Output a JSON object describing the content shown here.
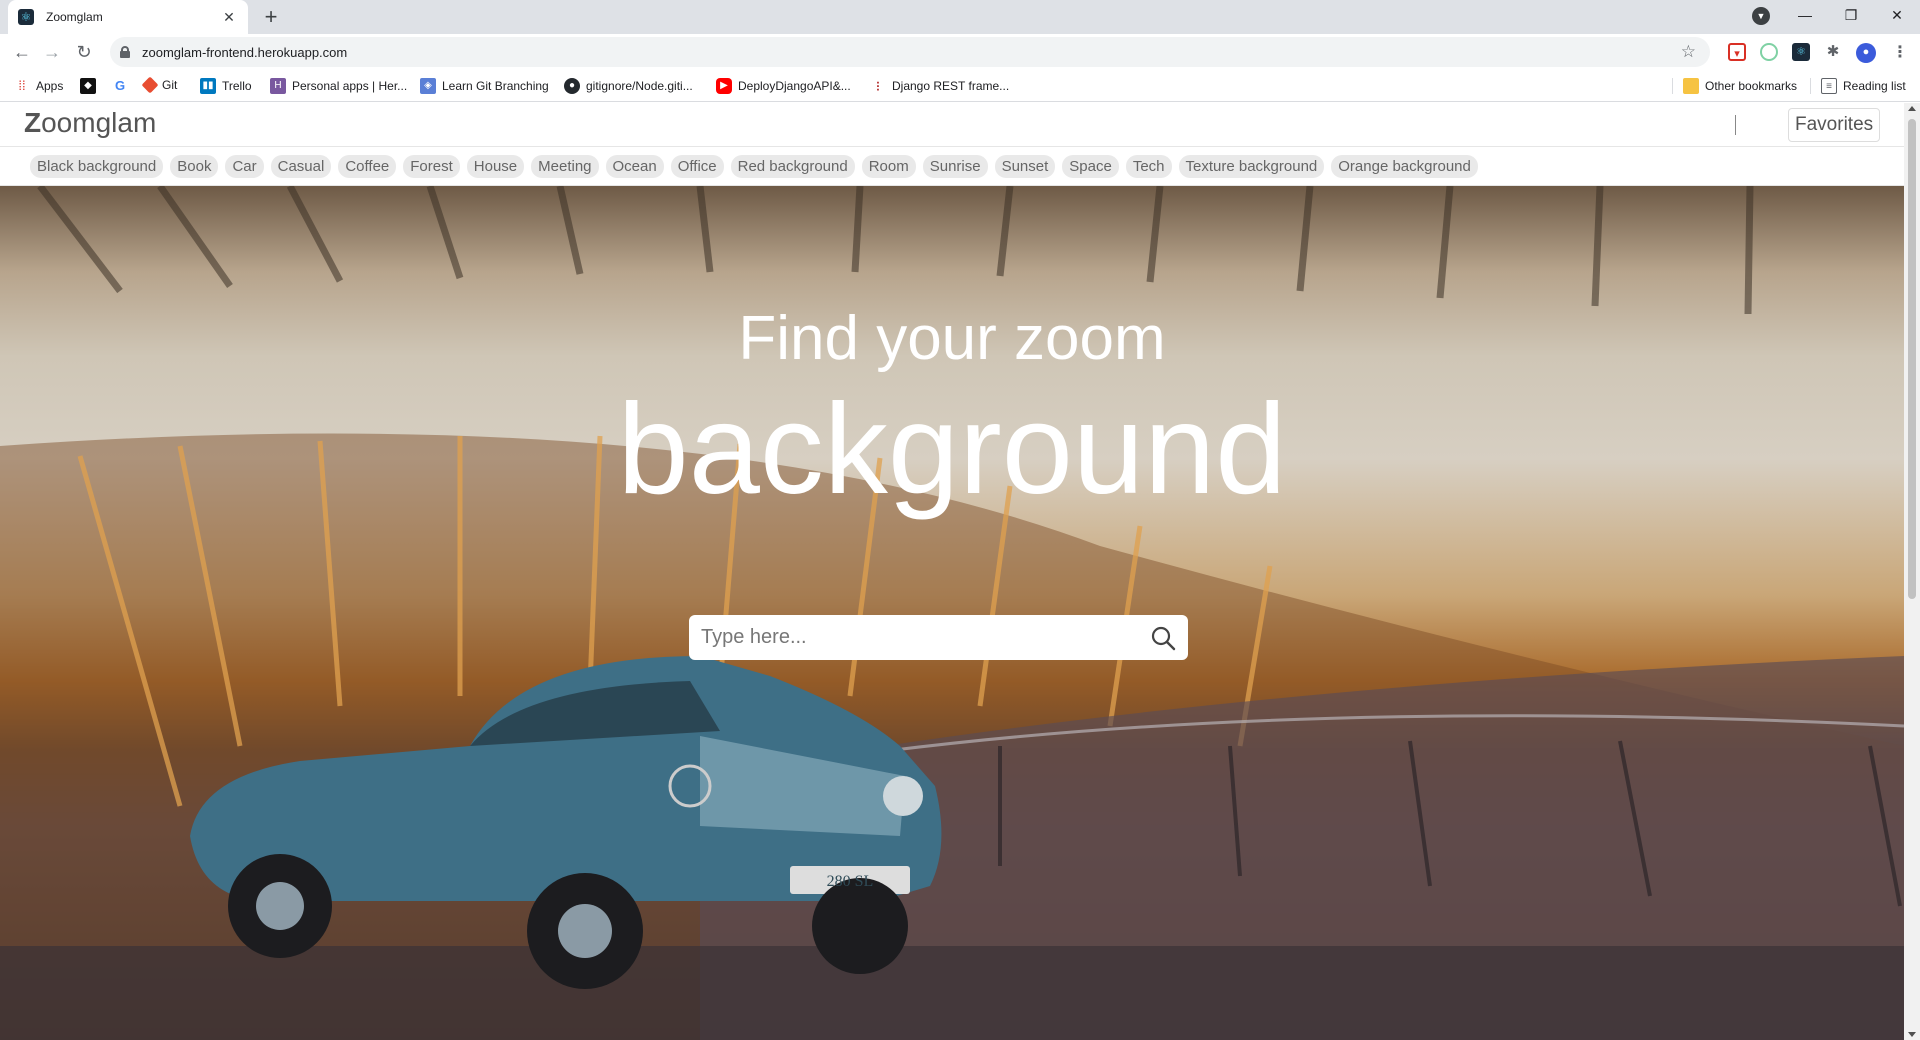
{
  "browser": {
    "tab_title": "Zoomglam",
    "url": "zoomglam-frontend.herokuapp.com",
    "bookmarks": [
      "Apps",
      "Git",
      "Trello",
      "Personal apps | Her...",
      "Learn Git Branching",
      "gitignore/Node.giti...",
      "DeployDjangoAPI&...",
      "Django REST frame..."
    ],
    "other_bookmarks": "Other bookmarks",
    "reading_list": "Reading list"
  },
  "site": {
    "brand_initial": "Z",
    "brand_rest": "oomglam",
    "favorites_label": "Favorites",
    "tags": [
      "Black background",
      "Book",
      "Car",
      "Casual",
      "Coffee",
      "Forest",
      "House",
      "Meeting",
      "Ocean",
      "Office",
      "Red background",
      "Room",
      "Sunrise",
      "Sunset",
      "Space",
      "Tech",
      "Texture background",
      "Orange background"
    ]
  },
  "hero": {
    "line1": "Find your zoom",
    "line2": "background",
    "search_placeholder": "Type here...",
    "plate_text": "280 SL"
  },
  "colors": {
    "car_body": "#3e6f86",
    "hero_overlay": "#ffffff"
  }
}
